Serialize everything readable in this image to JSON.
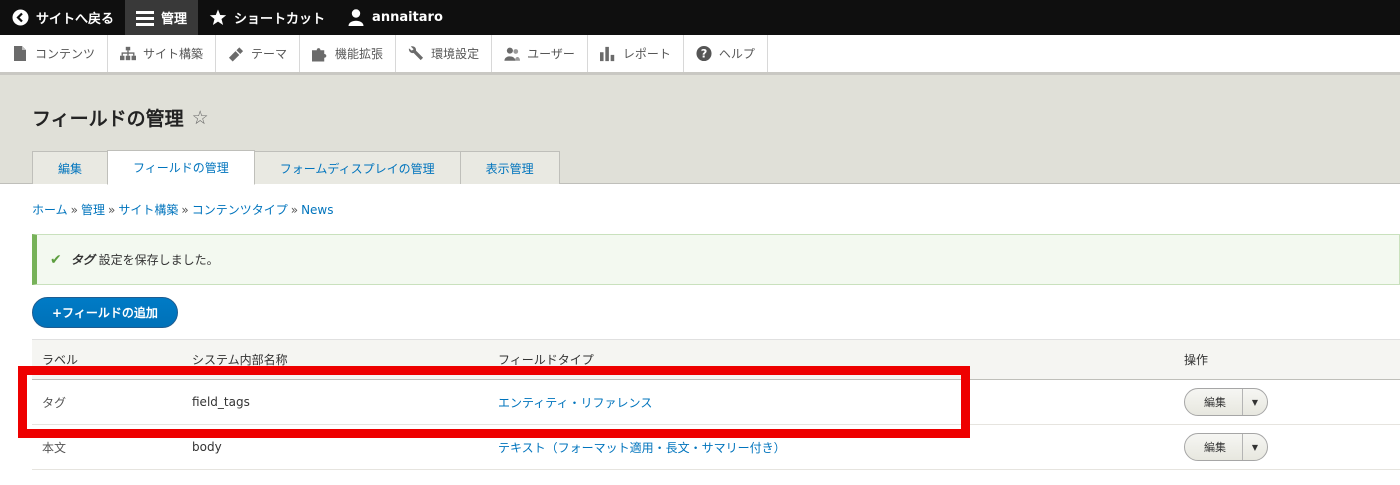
{
  "toolbar": {
    "back": "サイトへ戻る",
    "manage": "管理",
    "shortcuts": "ショートカット",
    "user": "annaitaro"
  },
  "tray": [
    {
      "label": "コンテンツ",
      "icon": "file-icon"
    },
    {
      "label": "サイト構築",
      "icon": "sitemap-icon"
    },
    {
      "label": "テーマ",
      "icon": "paintbrush-icon"
    },
    {
      "label": "機能拡張",
      "icon": "puzzle-icon"
    },
    {
      "label": "環境設定",
      "icon": "wrench-icon"
    },
    {
      "label": "ユーザー",
      "icon": "people-icon"
    },
    {
      "label": "レポート",
      "icon": "bar-chart-icon"
    },
    {
      "label": "ヘルプ",
      "icon": "help-icon"
    }
  ],
  "page": {
    "title": "フィールドの管理",
    "star": "☆"
  },
  "tabs": [
    {
      "label": "編集",
      "active": false
    },
    {
      "label": "フィールドの管理",
      "active": true
    },
    {
      "label": "フォームディスプレイの管理",
      "active": false
    },
    {
      "label": "表示管理",
      "active": false
    }
  ],
  "breadcrumb": {
    "items": [
      "ホーム",
      "管理",
      "サイト構築",
      "コンテンツタイプ",
      "News"
    ],
    "separator": "»"
  },
  "message": {
    "name": "タグ",
    "text": " 設定を保存しました。"
  },
  "add_button": "+フィールドの追加",
  "table": {
    "headers": [
      "ラベル",
      "システム内部名称",
      "フィールドタイプ",
      "操作"
    ],
    "rows": [
      {
        "label": "タグ",
        "machine": "field_tags",
        "type": "エンティティ・リファレンス",
        "op": "編集"
      },
      {
        "label": "本文",
        "machine": "body",
        "type": "テキスト（フォーマット適用・長文・サマリー付き）",
        "op": "編集"
      }
    ]
  },
  "colors": {
    "toolbar_bg": "#0f0f0f",
    "link": "#0074bd",
    "highlight": "#ee0000",
    "status_green": "#77b259"
  }
}
